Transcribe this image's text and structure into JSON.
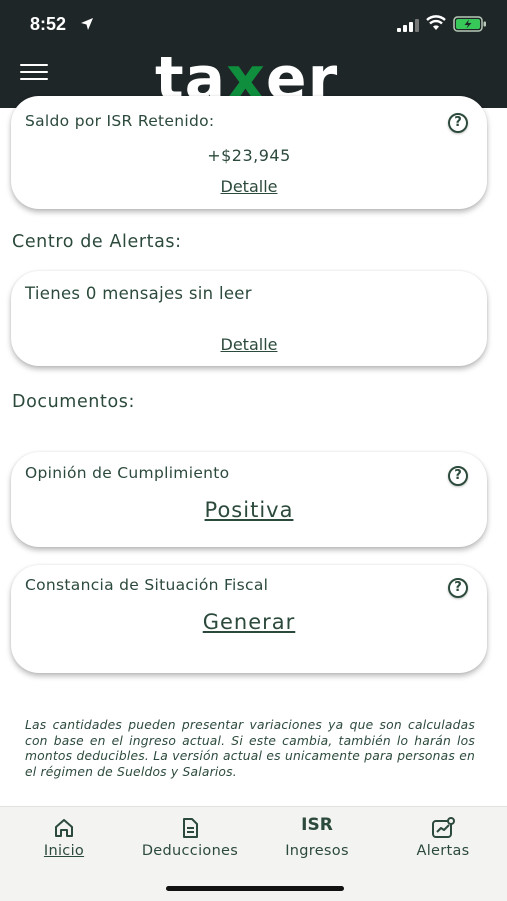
{
  "status_bar": {
    "time": "8:52"
  },
  "header": {
    "logo_prefix": "ta",
    "logo_x": "x",
    "logo_suffix": "er"
  },
  "isr_card": {
    "title": "Saldo por ISR Retenido:",
    "amount": "+$23,945",
    "link": "Detalle"
  },
  "alerts_section": {
    "title": "Centro de Alertas:"
  },
  "alerts_card": {
    "message": "Tienes 0 mensajes sin leer",
    "link": "Detalle"
  },
  "documents_section": {
    "title": "Documentos:"
  },
  "opinion_card": {
    "title": "Opinión de Cumplimiento",
    "value": "Positiva"
  },
  "constancia_card": {
    "title": "Constancia de Situación Fiscal",
    "action": "Generar"
  },
  "disclaimer": "Las cantidades pueden presentar variaciones ya que son calculadas con base en el ingreso actual. Si este cambia, también lo harán los montos deducibles. La versión actual es unicamente para personas en el régimen de Sueldos y Salarios.",
  "bottom_nav": {
    "items": [
      {
        "label": "Inicio",
        "icon": "home-icon",
        "active": true
      },
      {
        "label": "Deducciones",
        "icon": "document-icon"
      },
      {
        "label": "Ingresos",
        "icon": "isr-text",
        "icon_text": "ISR"
      },
      {
        "label": "Alertas",
        "icon": "chart-icon"
      }
    ]
  },
  "colors": {
    "header_bg": "#1f2628",
    "brand_green": "#0f8f3e",
    "text": "#2c4a3c",
    "nav_bg": "#f3f3f1"
  },
  "help_glyph": "?"
}
